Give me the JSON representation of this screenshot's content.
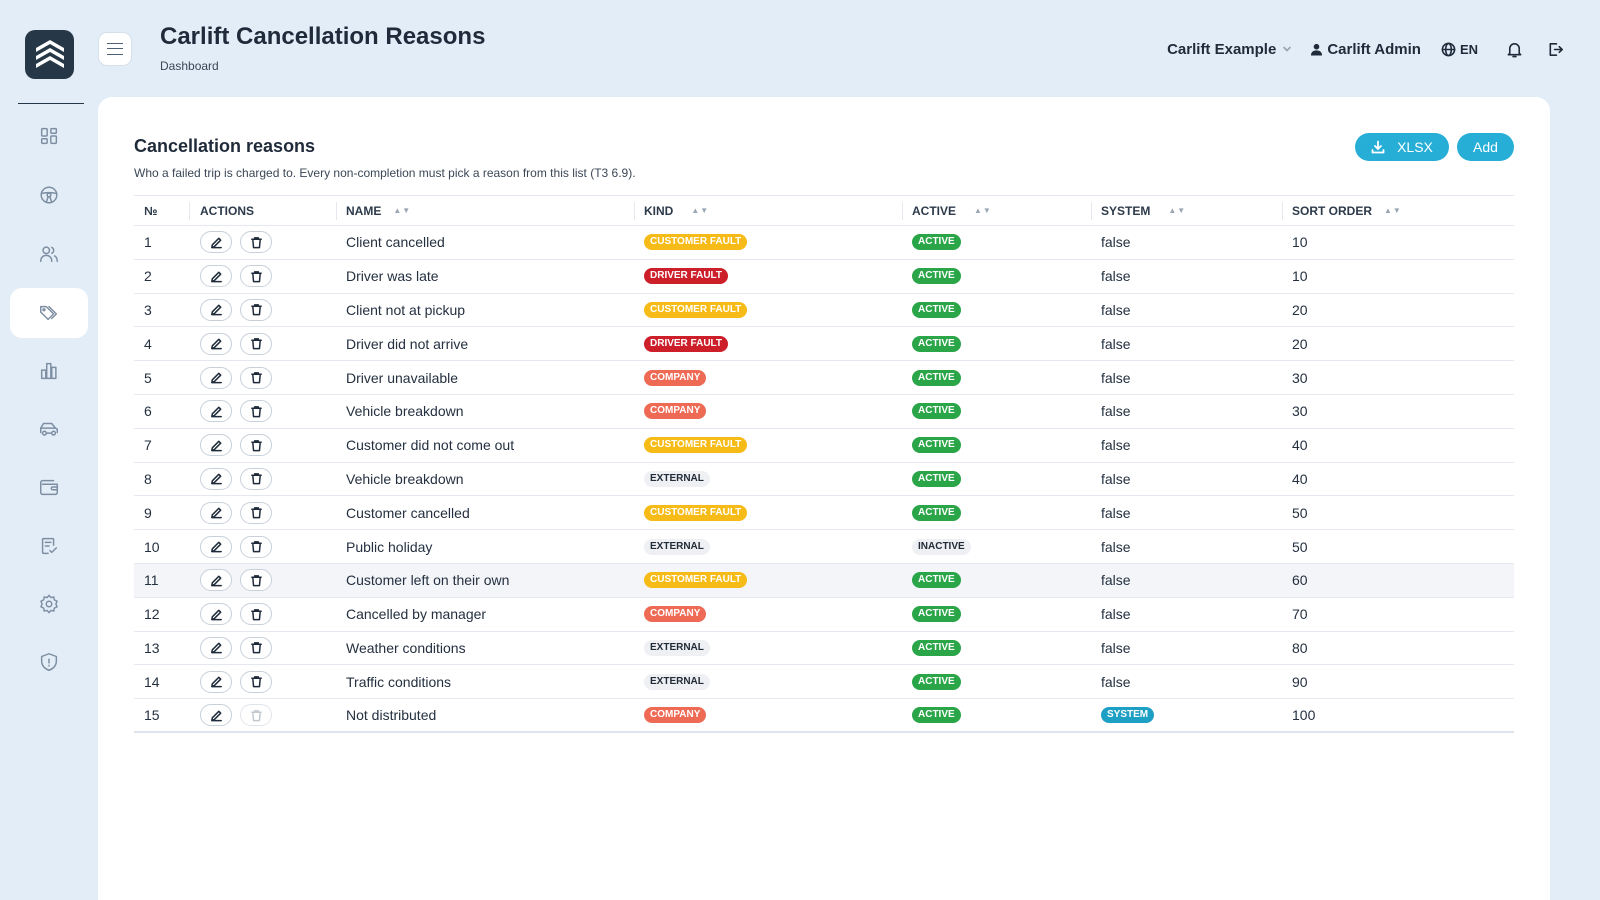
{
  "header": {
    "title": "Carlift Cancellation Reasons",
    "breadcrumb": "Dashboard",
    "company": "Carlift Example",
    "user": "Carlift Admin",
    "language": "EN"
  },
  "sidebar": {
    "items": [
      {
        "icon": "dashboard-icon"
      },
      {
        "icon": "steering-wheel-icon"
      },
      {
        "icon": "users-icon"
      },
      {
        "icon": "tags-icon",
        "active": true
      },
      {
        "icon": "bar-chart-icon"
      },
      {
        "icon": "car-icon"
      },
      {
        "icon": "wallet-icon"
      },
      {
        "icon": "checklist-icon"
      },
      {
        "icon": "gear-icon"
      },
      {
        "icon": "shield-icon"
      }
    ]
  },
  "card": {
    "title": "Cancellation reasons",
    "description": "Who a failed trip is charged to. Every non-completion must pick a reason from this list (T3 6.9).",
    "xlsx_label": "XLSX",
    "add_label": "Add"
  },
  "table": {
    "columns": {
      "no": "№",
      "actions": "ACTIONS",
      "name": "NAME",
      "kind": "KIND",
      "active": "ACTIVE",
      "system": "SYSTEM",
      "sort_order": "SORT ORDER"
    },
    "rows": [
      {
        "no": "1",
        "name": "Client cancelled",
        "kind": "CUSTOMER FAULT",
        "kind_class": "b-customer",
        "active": "ACTIVE",
        "active_class": "b-active",
        "system": "false",
        "sort": "10"
      },
      {
        "no": "2",
        "name": "Driver was late",
        "kind": "DRIVER FAULT",
        "kind_class": "b-driver",
        "active": "ACTIVE",
        "active_class": "b-active",
        "system": "false",
        "sort": "10"
      },
      {
        "no": "3",
        "name": "Client not at pickup",
        "kind": "CUSTOMER FAULT",
        "kind_class": "b-customer",
        "active": "ACTIVE",
        "active_class": "b-active",
        "system": "false",
        "sort": "20"
      },
      {
        "no": "4",
        "name": "Driver did not arrive",
        "kind": "DRIVER FAULT",
        "kind_class": "b-driver",
        "active": "ACTIVE",
        "active_class": "b-active",
        "system": "false",
        "sort": "20"
      },
      {
        "no": "5",
        "name": "Driver unavailable",
        "kind": "COMPANY",
        "kind_class": "b-company",
        "active": "ACTIVE",
        "active_class": "b-active",
        "system": "false",
        "sort": "30"
      },
      {
        "no": "6",
        "name": "Vehicle breakdown",
        "kind": "COMPANY",
        "kind_class": "b-company",
        "active": "ACTIVE",
        "active_class": "b-active",
        "system": "false",
        "sort": "30"
      },
      {
        "no": "7",
        "name": "Customer did not come out",
        "kind": "CUSTOMER FAULT",
        "kind_class": "b-customer",
        "active": "ACTIVE",
        "active_class": "b-active",
        "system": "false",
        "sort": "40"
      },
      {
        "no": "8",
        "name": "Vehicle breakdown",
        "kind": "EXTERNAL",
        "kind_class": "b-external",
        "active": "ACTIVE",
        "active_class": "b-active",
        "system": "false",
        "sort": "40"
      },
      {
        "no": "9",
        "name": "Customer cancelled",
        "kind": "CUSTOMER FAULT",
        "kind_class": "b-customer",
        "active": "ACTIVE",
        "active_class": "b-active",
        "system": "false",
        "sort": "50"
      },
      {
        "no": "10",
        "name": "Public holiday",
        "kind": "EXTERNAL",
        "kind_class": "b-external",
        "active": "INACTIVE",
        "active_class": "b-inactive",
        "system": "false",
        "sort": "50"
      },
      {
        "no": "11",
        "name": "Customer left on their own",
        "kind": "CUSTOMER FAULT",
        "kind_class": "b-customer",
        "active": "ACTIVE",
        "active_class": "b-active",
        "system": "false",
        "sort": "60",
        "highlight": true
      },
      {
        "no": "12",
        "name": "Cancelled by manager",
        "kind": "COMPANY",
        "kind_class": "b-company",
        "active": "ACTIVE",
        "active_class": "b-active",
        "system": "false",
        "sort": "70"
      },
      {
        "no": "13",
        "name": "Weather conditions",
        "kind": "EXTERNAL",
        "kind_class": "b-external",
        "active": "ACTIVE",
        "active_class": "b-active",
        "system": "false",
        "sort": "80"
      },
      {
        "no": "14",
        "name": "Traffic conditions",
        "kind": "EXTERNAL",
        "kind_class": "b-external",
        "active": "ACTIVE",
        "active_class": "b-active",
        "system": "false",
        "sort": "90"
      },
      {
        "no": "15",
        "name": "Not distributed",
        "kind": "COMPANY",
        "kind_class": "b-company",
        "active": "ACTIVE",
        "active_class": "b-active",
        "system": "SYSTEM",
        "system_badge": true,
        "sort": "100",
        "delete_disabled": true
      }
    ]
  },
  "colors": {
    "accent": "#26aed6",
    "customer_fault": "#f7bb17",
    "driver_fault": "#cc1f2a",
    "company": "#ef6a55",
    "active": "#2aa548",
    "system": "#1e9fc4"
  }
}
